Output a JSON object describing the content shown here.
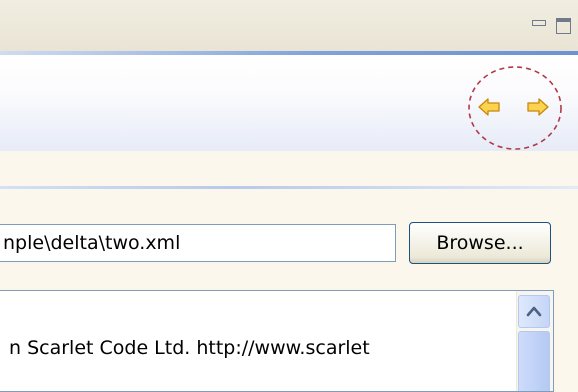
{
  "window": {
    "minimize_icon": "minimize-icon",
    "maximize_icon": "maximize-icon"
  },
  "navigation": {
    "back_icon": "arrow-left-icon",
    "forward_icon": "arrow-right-icon",
    "arrow_color": "#f2b712",
    "highlight_color": "#b23a48"
  },
  "file_input": {
    "value": "nple\\delta\\two.xml"
  },
  "browse_button": {
    "label": "Browse..."
  },
  "content": {
    "text": "n Scarlet Code Ltd.  http://www.scarlet"
  },
  "scrollbar": {
    "up_icon": "chevron-up-icon"
  }
}
